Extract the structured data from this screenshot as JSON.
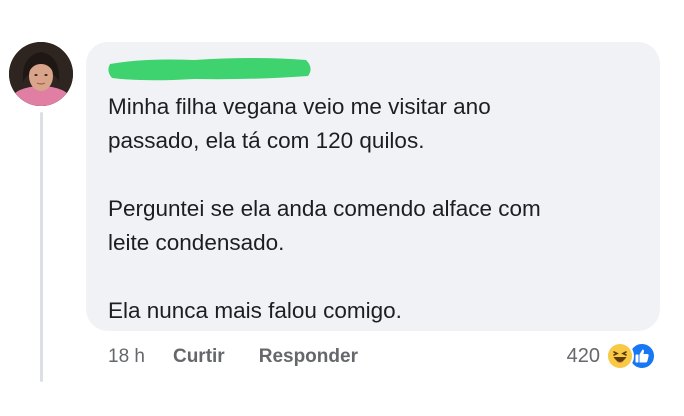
{
  "comment": {
    "author_redacted": true,
    "lines": [
      "Minha filha vegana veio me visitar ano\npassado, ela tá com 120 quilos.",
      "Perguntei se ela anda comendo alface com\nleite condensado.",
      "Ela nunca mais falou comigo."
    ],
    "timestamp": "18 h",
    "like_action": "Curtir",
    "reply_action": "Responder",
    "reaction_count": "420",
    "reaction_icons": [
      "haha-icon",
      "like-icon"
    ],
    "colors": {
      "bubble": "#f0f2f5",
      "redaction": "#3ed36f",
      "meta_text": "#65676b",
      "like_blue": "#1877f2",
      "haha_yellow": "#f7c944"
    }
  }
}
